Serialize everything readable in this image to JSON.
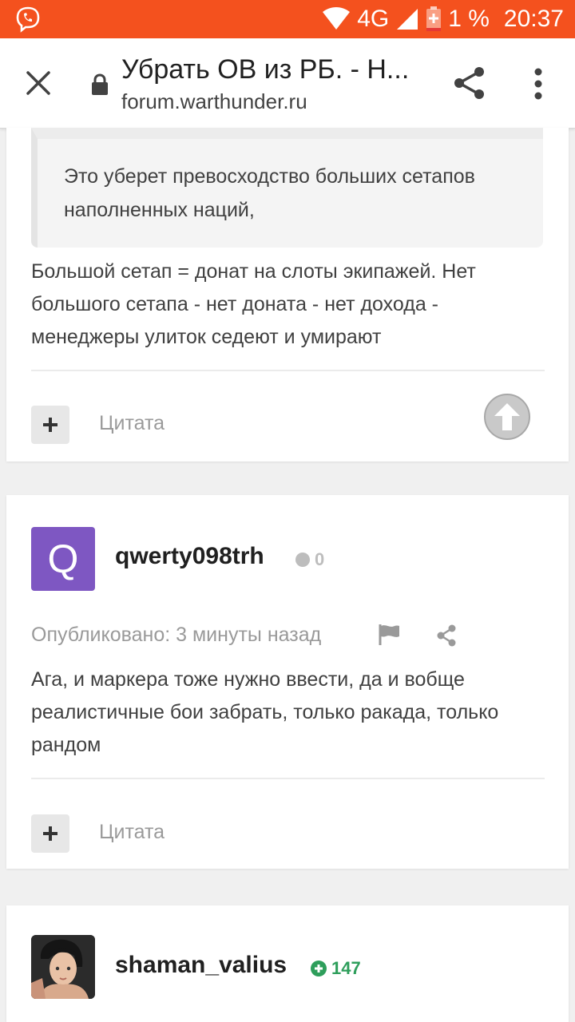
{
  "status_bar": {
    "network": "4G",
    "battery": "1 %",
    "time": "20:37"
  },
  "browser": {
    "page_title": "Убрать ОВ из РБ. - Н...",
    "url": "forum.warthunder.ru"
  },
  "posts": [
    {
      "quote_text": "Это уберет превосходство больших сетапов наполненных наций,",
      "text": "Большой сетап = донат на слоты экипажей. Нет большого сетапа - нет доната - нет дохода - менеджеры улиток седеют и умирают",
      "quote_button": "Цитата"
    },
    {
      "avatar_letter": "Q",
      "username": "qwerty098trh",
      "reputation": "0",
      "published": "Опубликовано: 3 минуты назад",
      "text": "Ага, и маркера тоже нужно ввести, да и вобще реалистичные бои забрать, только ракада, только рандом",
      "quote_button": "Цитата"
    },
    {
      "username": "shaman_valius",
      "reputation": "147"
    }
  ],
  "colors": {
    "status_bar": "#f4511e",
    "avatar_q": "#7e57c2",
    "rep_positive": "#2e9e5b",
    "rep_neutral": "#bdbdbd"
  }
}
